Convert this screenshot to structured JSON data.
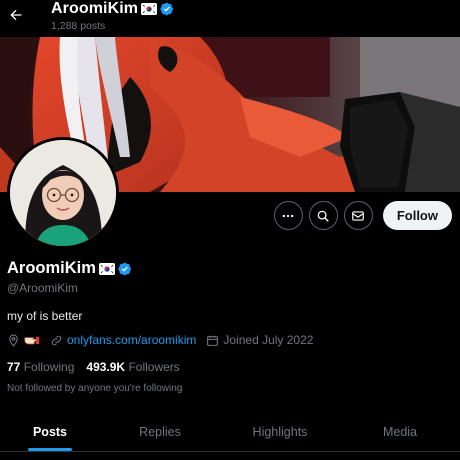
{
  "header": {
    "back_icon": "arrow-left-icon",
    "name": "AroomiKim",
    "posts_count": "1,288 posts"
  },
  "profile": {
    "display_name": "AroomiKim",
    "flag_icon": "south-korea-flag-icon",
    "verified_icon": "verified-badge-icon",
    "handle": "@AroomiKim",
    "bio": "my of is better",
    "location_icon": "location-pin-icon",
    "location_emoji": "pointing-hand-icon",
    "link_icon": "link-icon",
    "link_text": "onlyfans.com/aroomikim",
    "calendar_icon": "calendar-icon",
    "joined": "Joined July 2022",
    "following_count": "77",
    "following_label": "Following",
    "followers_count": "493.9K",
    "followers_label": "Followers",
    "not_followed_text": "Not followed by anyone you're following"
  },
  "actions": {
    "more_icon": "more-icon",
    "search_icon": "search-icon",
    "message_icon": "envelope-icon",
    "follow_label": "Follow"
  },
  "tabs": [
    {
      "label": "Posts",
      "active": true
    },
    {
      "label": "Replies",
      "active": false
    },
    {
      "label": "Highlights",
      "active": false
    },
    {
      "label": "Media",
      "active": false
    }
  ],
  "colors": {
    "accent": "#1d9bf0",
    "background": "#000000",
    "secondary_text": "#71767b"
  }
}
